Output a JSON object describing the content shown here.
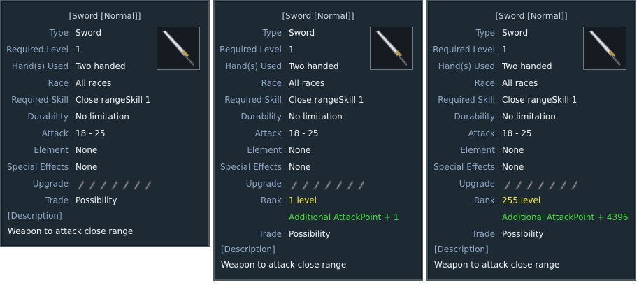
{
  "panels": [
    {
      "title": "[Sword [Normal]]",
      "rows": [
        {
          "label": "Type",
          "value": "Sword"
        },
        {
          "label": "Required Level",
          "value": "1"
        },
        {
          "label": "Hand(s) Used",
          "value": "Two handed"
        },
        {
          "label": "Race",
          "value": "All races"
        },
        {
          "label": "Required Skill",
          "value": "Close rangeSkill 1"
        },
        {
          "label": "Durability",
          "value": "No limitation"
        },
        {
          "label": "Attack",
          "value": "18 - 25"
        },
        {
          "label": "Element",
          "value": "None"
        },
        {
          "label": "Special Effects",
          "value": "None"
        },
        {
          "label": "Upgrade",
          "slots": 7
        },
        {
          "label": "Trade",
          "value": "Possibility"
        }
      ],
      "description_label": "[Description]",
      "description": "Weapon to attack close range"
    },
    {
      "title": "[Sword [Normal]]",
      "rows": [
        {
          "label": "Type",
          "value": "Sword"
        },
        {
          "label": "Required Level",
          "value": "1"
        },
        {
          "label": "Hand(s) Used",
          "value": "Two handed"
        },
        {
          "label": "Race",
          "value": "All races"
        },
        {
          "label": "Required Skill",
          "value": "Close rangeSkill 1"
        },
        {
          "label": "Durability",
          "value": "No limitation"
        },
        {
          "label": "Attack",
          "value": "18 - 25"
        },
        {
          "label": "Element",
          "value": "None"
        },
        {
          "label": "Special Effects",
          "value": "None"
        },
        {
          "label": "Upgrade",
          "slots": 7
        },
        {
          "label": "Rank",
          "value": "1 level",
          "color": "yellow"
        },
        {
          "label": "",
          "value": "Additional AttackPoint + 1",
          "color": "green"
        },
        {
          "label": "Trade",
          "value": "Possibility"
        }
      ],
      "description_label": "[Description]",
      "description": "Weapon to attack close range"
    },
    {
      "title": "[Sword [Normal]]",
      "rows": [
        {
          "label": "Type",
          "value": "Sword"
        },
        {
          "label": "Required Level",
          "value": "1"
        },
        {
          "label": "Hand(s) Used",
          "value": "Two handed"
        },
        {
          "label": "Race",
          "value": "All races"
        },
        {
          "label": "Required Skill",
          "value": "Close rangeSkill 1"
        },
        {
          "label": "Durability",
          "value": "No limitation"
        },
        {
          "label": "Attack",
          "value": "18 - 25"
        },
        {
          "label": "Element",
          "value": "None"
        },
        {
          "label": "Special Effects",
          "value": "None"
        },
        {
          "label": "Upgrade",
          "slots": 7
        },
        {
          "label": "Rank",
          "value": "255 level",
          "color": "yellow"
        },
        {
          "label": "",
          "value": "Additional AttackPoint + 4396",
          "color": "green"
        },
        {
          "label": "Trade",
          "value": "Possibility"
        }
      ],
      "description_label": "[Description]",
      "description": "Weapon to attack close range"
    }
  ],
  "icons": {
    "item": "sword-icon",
    "upgrade_slot": "upgrade-slot-icon"
  },
  "colors": {
    "panel_bg": "#1d2933",
    "label": "#8ea7c7",
    "value": "#f1f3f4",
    "rank": "#f4ef3a",
    "bonus": "#45dd3b"
  }
}
